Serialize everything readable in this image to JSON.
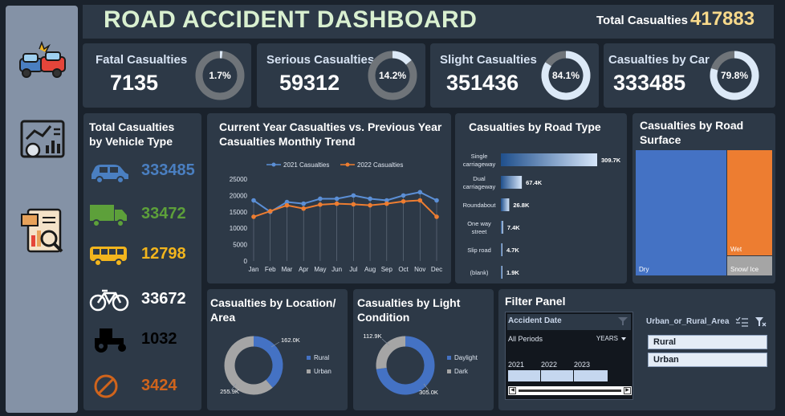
{
  "header": {
    "title": "ROAD ACCIDENT DASHBOARD",
    "total_label": "Total Casualties",
    "total_value": "417883"
  },
  "sidebar": {
    "icons": [
      "car-crash-icon",
      "dashboard-analytics-icon",
      "report-search-icon"
    ]
  },
  "kpis": [
    {
      "label": "Fatal Casualties",
      "value": "7135",
      "pct": "1.7%",
      "fraction": 0.017
    },
    {
      "label": "Serious Casualties",
      "value": "59312",
      "pct": "14.2%",
      "fraction": 0.142
    },
    {
      "label": "Slight Casualties",
      "value": "351436",
      "pct": "84.1%",
      "fraction": 0.841
    },
    {
      "label": "Casualties by Car",
      "value": "333485",
      "pct": "79.8%",
      "fraction": 0.798
    }
  ],
  "vehicle": {
    "title_line1": "Total Casualties",
    "title_line2": "by Vehicle Type",
    "rows": [
      {
        "icon": "car-icon",
        "value": "333485",
        "color": "#4a7fc1"
      },
      {
        "icon": "truck-icon",
        "value": "33472",
        "color": "#5da03a"
      },
      {
        "icon": "bus-icon",
        "value": "12798",
        "color": "#f2b51d"
      },
      {
        "icon": "bicycle-icon",
        "value": "33672",
        "color": "#ffffff"
      },
      {
        "icon": "tractor-icon",
        "value": "1032",
        "color": "#000000"
      },
      {
        "icon": "prohibited-icon",
        "value": "3424",
        "color": "#d0641c"
      }
    ]
  },
  "trend": {
    "title_line1": "Current Year Casualties vs. Previous Year",
    "title_line2": "Casualties Monthly Trend",
    "chart_data": {
      "type": "line",
      "categories": [
        "Jan",
        "Feb",
        "Mar",
        "Apr",
        "May",
        "Jun",
        "Jul",
        "Aug",
        "Sep",
        "Oct",
        "Nov",
        "Dec"
      ],
      "series": [
        {
          "name": "2021 Casualties",
          "values": [
            18500,
            15000,
            18000,
            17500,
            19000,
            19000,
            20000,
            19000,
            18500,
            20000,
            21000,
            18500
          ],
          "color": "#5b8fd6"
        },
        {
          "name": "2022 Casualties",
          "values": [
            13500,
            15200,
            17000,
            16000,
            17200,
            17500,
            17300,
            17000,
            17500,
            18200,
            18500,
            13500
          ],
          "color": "#ed7d31"
        }
      ],
      "ylim": [
        0,
        25000
      ],
      "yticks": [
        "0",
        "5000",
        "10000",
        "15000",
        "20000",
        "25000"
      ],
      "legend": "top"
    }
  },
  "road_type": {
    "title": "Casualties by Road Type",
    "chart_data": {
      "type": "bar",
      "categories": [
        "Single carriageway",
        "Dual carriageway",
        "Roundabout",
        "One way street",
        "Slip road",
        "(blank)"
      ],
      "label_lines": [
        [
          "Single",
          "carriageway"
        ],
        [
          "Dual",
          "carriageway"
        ],
        [
          "Roundabout"
        ],
        [
          "One way",
          "street"
        ],
        [
          "Slip road"
        ],
        [
          "(blank)"
        ]
      ],
      "values": [
        309700,
        67400,
        26800,
        7400,
        4700,
        1900
      ],
      "data_labels": [
        "309.7K",
        "67.4K",
        "26.8K",
        "7.4K",
        "4.7K",
        "1.9K"
      ]
    }
  },
  "road_surface": {
    "title_line1": "Casualties by Road",
    "title_line2": "Surface",
    "chart_data": {
      "type": "treemap",
      "categories": [
        "Dry",
        "Wet",
        "Snow/ Ice"
      ],
      "colors": [
        "#4472c4",
        "#ed7d31",
        "#a5a5a5"
      ]
    }
  },
  "location": {
    "title_line1": "Casualties by Location/",
    "title_line2": "Area",
    "chart_data": {
      "type": "pie",
      "categories": [
        "Rural",
        "Urban"
      ],
      "values": [
        162000,
        255900
      ],
      "data_labels": [
        "162.0K",
        "255.9K"
      ],
      "colors": [
        "#4472c4",
        "#a5a5a5"
      ]
    }
  },
  "light": {
    "title_line1": "Casualties by Light",
    "title_line2": "Condition",
    "chart_data": {
      "type": "pie",
      "categories": [
        "Daylight",
        "Dark"
      ],
      "values": [
        305000,
        112900
      ],
      "data_labels": [
        "305.0K",
        "112.9K"
      ],
      "colors": [
        "#4472c4",
        "#a5a5a5"
      ]
    }
  },
  "filter": {
    "title": "Filter Panel",
    "date_slicer": {
      "title": "Accident Date",
      "period": "All Periods",
      "level": "YEARS",
      "years": [
        "2021",
        "2022",
        "2023"
      ]
    },
    "area_slicer": {
      "title": "Urban_or_Rural_Area",
      "options": [
        "Rural",
        "Urban"
      ]
    }
  }
}
